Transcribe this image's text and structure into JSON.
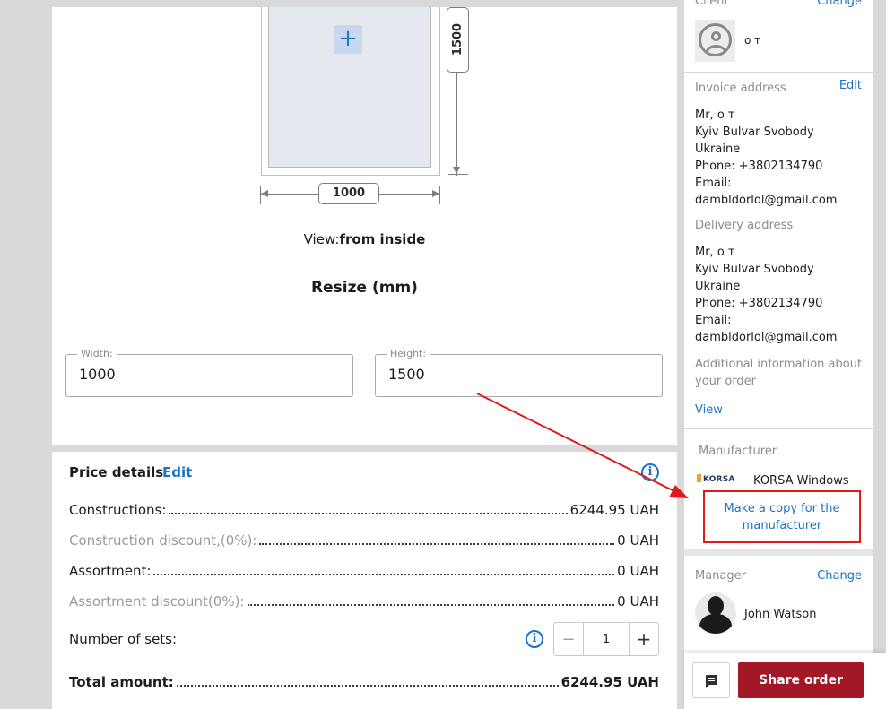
{
  "preview": {
    "add_symbol": "+",
    "width_dim": "1000",
    "height_dim": "1500",
    "view_label": "View:",
    "view_value": "from inside",
    "resize_title": "Resize (mm)",
    "width_field": {
      "label": "Width:",
      "value": "1000"
    },
    "height_field": {
      "label": "Height:",
      "value": "1500"
    }
  },
  "price": {
    "title": "Price details",
    "edit_label": "Edit",
    "info_symbol": "i",
    "rows": [
      {
        "label": "Constructions:",
        "value": "6244.95 UAH",
        "muted": false
      },
      {
        "label": "Construction discount,(0%):",
        "value": "0 UAH",
        "muted": true
      },
      {
        "label": "Assortment:",
        "value": "0 UAH",
        "muted": false
      },
      {
        "label": "Assortment discount(0%):",
        "value": "0 UAH",
        "muted": true
      }
    ],
    "sets_label": "Number of sets:",
    "sets_value": "1",
    "minus": "−",
    "plus": "+",
    "total_label": "Total amount:",
    "total_value": "6244.95 UAH"
  },
  "sidebar": {
    "client_label": "Client",
    "client_change": "Change",
    "client_name": "о т",
    "invoice_label": "Invoice address",
    "invoice_edit": "Edit",
    "invoice_lines": [
      "Mr, о т",
      "Kyiv Bulvar Svobody",
      "Ukraine",
      "Phone: +3802134790",
      "Email:",
      "dambldorlol@gmail.com"
    ],
    "delivery_label": "Delivery address",
    "delivery_lines": [
      "Mr, о т",
      "Kyiv Bulvar Svobody",
      "Ukraine",
      "Phone: +3802134790",
      "Email:",
      "dambldorlol@gmail.com"
    ],
    "additional_info": "Additional information about your order",
    "view_link": "View",
    "manufacturer_label": "Manufacturer",
    "manufacturer_logo": "KORSA",
    "manufacturer_name": "KORSA Windows",
    "copy_button": "Make a copy for the manufacturer",
    "manager_label": "Manager",
    "manager_change": "Change",
    "manager_name": "John Watson"
  },
  "bottom": {
    "chat_icon": "message-icon",
    "share_label": "Share order"
  },
  "colors": {
    "link": "#1d72c4",
    "share": "#a31827",
    "annotation": "#e31919"
  }
}
